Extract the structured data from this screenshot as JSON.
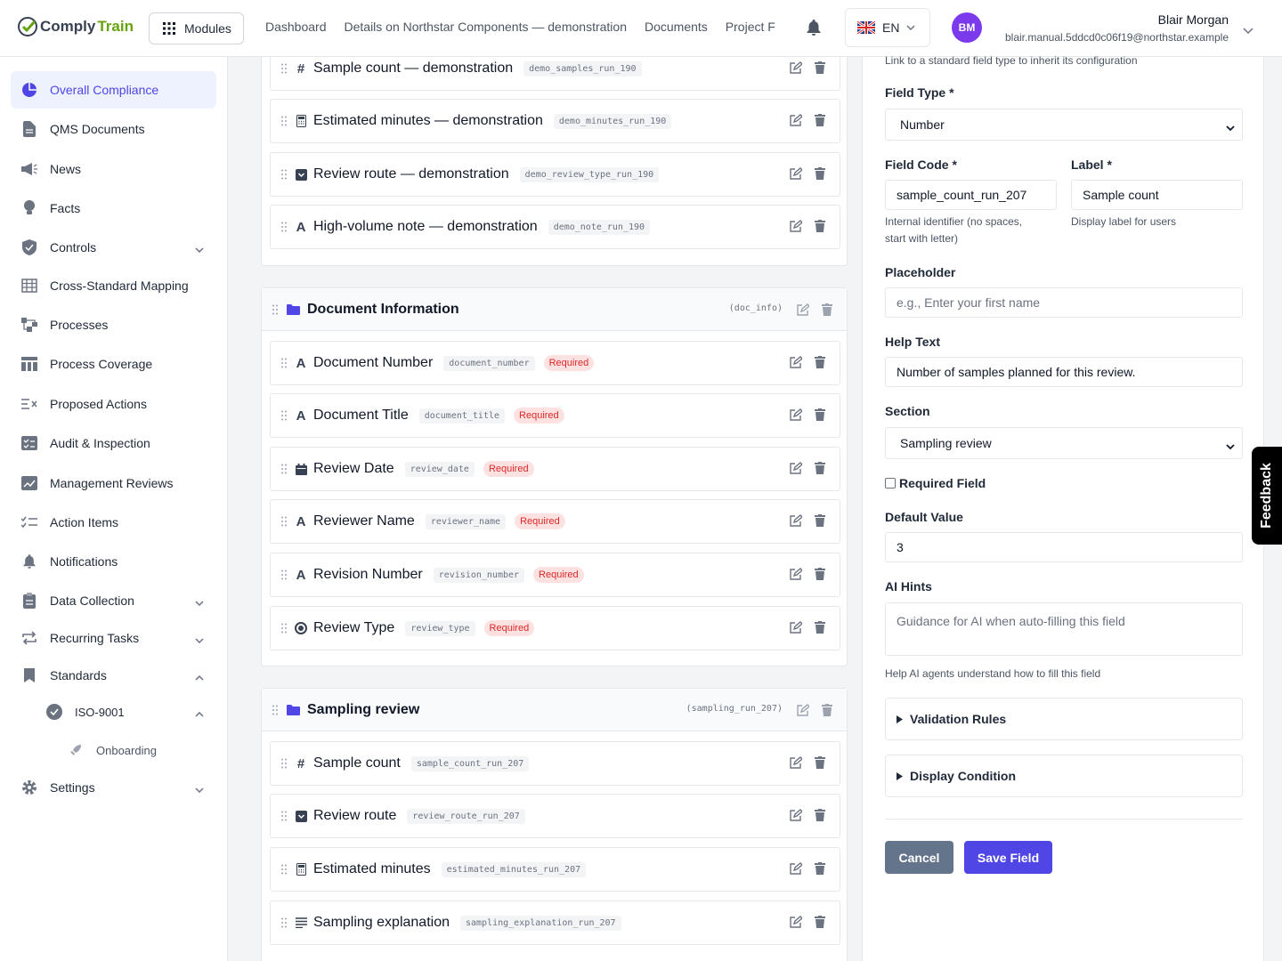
{
  "app": {
    "brand_part1": "Comply",
    "brand_part2": "Train",
    "brand_color": "#65a30d",
    "accent_color": "#4f46e5"
  },
  "header": {
    "modules_label": "Modules",
    "nav": [
      "Dashboard",
      "Details on Northstar Components — demonstration",
      "Documents",
      "Project F"
    ],
    "language": "EN",
    "user_initials": "BM",
    "user_name": "Blair Morgan",
    "user_email": "blair.manual.5ddcd0c06f19@northstar.example"
  },
  "sidebar": {
    "items": [
      {
        "label": "Overall Compliance",
        "icon": "pie-chart-icon",
        "active": true
      },
      {
        "label": "QMS Documents",
        "icon": "document-icon"
      },
      {
        "label": "News",
        "icon": "megaphone-icon"
      },
      {
        "label": "Facts",
        "icon": "lightbulb-icon"
      },
      {
        "label": "Controls",
        "icon": "shield-icon",
        "chevron": "down"
      },
      {
        "label": "Cross-Standard Mapping",
        "icon": "grid-icon"
      },
      {
        "label": "Processes",
        "icon": "flow-icon"
      },
      {
        "label": "Process Coverage",
        "icon": "table-icon"
      },
      {
        "label": "Proposed Actions",
        "icon": "list-x-icon"
      },
      {
        "label": "Audit & Inspection",
        "icon": "checklist-icon"
      },
      {
        "label": "Management Reviews",
        "icon": "chart-edit-icon"
      },
      {
        "label": "Action Items",
        "icon": "tasks-icon"
      },
      {
        "label": "Notifications",
        "icon": "bell-icon"
      },
      {
        "label": "Data Collection",
        "icon": "clipboard-icon",
        "chevron": "down"
      },
      {
        "label": "Recurring Tasks",
        "icon": "repeat-icon",
        "chevron": "down"
      },
      {
        "label": "Standards",
        "icon": "bookmark-icon",
        "chevron": "up"
      },
      {
        "label": "ISO-9001",
        "icon": "badge-check-icon",
        "chevron": "up"
      },
      {
        "label": "Onboarding",
        "icon": "rocket-icon"
      },
      {
        "label": "Settings",
        "icon": "gear-icon",
        "chevron": "down"
      }
    ]
  },
  "top_fields": [
    {
      "label": "Sample count — demonstration",
      "code": "demo_samples_run_190",
      "type": "#"
    },
    {
      "label": "Estimated minutes — demonstration",
      "code": "demo_minutes_run_190",
      "type": "calc"
    },
    {
      "label": "Review route — demonstration",
      "code": "demo_review_type_run_190",
      "type": "dropdown"
    },
    {
      "label": "High-volume note — demonstration",
      "code": "demo_note_run_190",
      "type": "A"
    }
  ],
  "doc_section": {
    "title": "Document Information",
    "code": "(doc_info)",
    "fields": [
      {
        "label": "Document Number",
        "code": "document_number",
        "type": "A",
        "required": "Required"
      },
      {
        "label": "Document Title",
        "code": "document_title",
        "type": "A",
        "required": "Required"
      },
      {
        "label": "Review Date",
        "code": "review_date",
        "type": "calendar",
        "required": "Required"
      },
      {
        "label": "Reviewer Name",
        "code": "reviewer_name",
        "type": "A",
        "required": "Required"
      },
      {
        "label": "Revision Number",
        "code": "revision_number",
        "type": "A",
        "required": "Required"
      },
      {
        "label": "Review Type",
        "code": "review_type",
        "type": "radio",
        "required": "Required"
      }
    ]
  },
  "sampling_section": {
    "title": "Sampling review",
    "code": "(sampling_run_207)",
    "fields": [
      {
        "label": "Sample count",
        "code": "sample_count_run_207",
        "type": "#"
      },
      {
        "label": "Review route",
        "code": "review_route_run_207",
        "type": "dropdown"
      },
      {
        "label": "Estimated minutes",
        "code": "estimated_minutes_run_207",
        "type": "calc"
      },
      {
        "label": "Sampling explanation",
        "code": "sampling_explanation_run_207",
        "type": "textlines"
      }
    ]
  },
  "panel": {
    "std_help": "Link to a standard field type to inherit its configuration",
    "field_type_label": "Field Type *",
    "field_type_value": "Number",
    "field_code_label": "Field Code *",
    "field_code_value": "sample_count_run_207",
    "field_code_help_1": "Internal identifier (no spaces,",
    "field_code_help_2": "start with letter)",
    "label_label": "Label *",
    "label_value": "Sample count",
    "label_help": "Display label for users",
    "placeholder_label": "Placeholder",
    "placeholder_placeholder": "e.g., Enter your first name",
    "help_text_label": "Help Text",
    "help_text_value": "Number of samples planned for this review.",
    "section_label": "Section",
    "section_value": "Sampling review",
    "required_label": "Required Field",
    "default_label": "Default Value",
    "default_value": "3",
    "ai_hints_label": "AI Hints",
    "ai_hints_placeholder": "Guidance for AI when auto-filling this field",
    "ai_hints_help": "Help AI agents understand how to fill this field",
    "validation_label": "Validation Rules",
    "display_condition_label": "Display Condition",
    "cancel_label": "Cancel",
    "save_label": "Save Field"
  },
  "feedback_label": "Feedback"
}
